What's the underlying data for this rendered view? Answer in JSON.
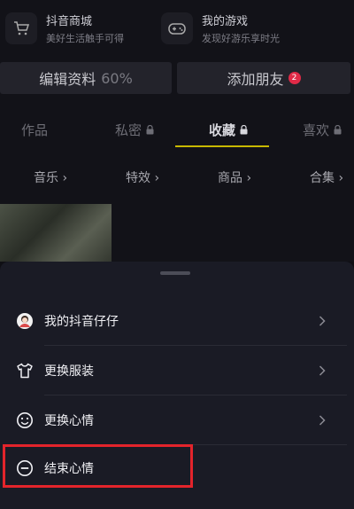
{
  "shortcuts": [
    {
      "title": "抖音商城",
      "subtitle": "美好生活触手可得",
      "icon": "cart-icon"
    },
    {
      "title": "我的游戏",
      "subtitle": "发现好游乐享时光",
      "icon": "gamepad-icon"
    }
  ],
  "actions": {
    "edit_profile": "编辑资料",
    "edit_progress": "60%",
    "add_friends": "添加朋友",
    "add_friends_badge": "2"
  },
  "tabs": [
    "作品",
    "私密",
    "收藏",
    "喜欢"
  ],
  "active_tab": "收藏",
  "subtabs": [
    "音乐",
    "特效",
    "商品",
    "合集"
  ],
  "sheet": {
    "items": [
      {
        "label": "我的抖音仔仔",
        "icon": "avatar-icon"
      },
      {
        "label": "更换服装",
        "icon": "shirt-icon"
      },
      {
        "label": "更换心情",
        "icon": "smiley-icon"
      },
      {
        "label": "结束心情",
        "icon": "minus-circle-icon"
      }
    ]
  },
  "colors": {
    "accent_underline": "#c8b800",
    "badge": "#e02a47",
    "highlight": "#e3242b"
  }
}
